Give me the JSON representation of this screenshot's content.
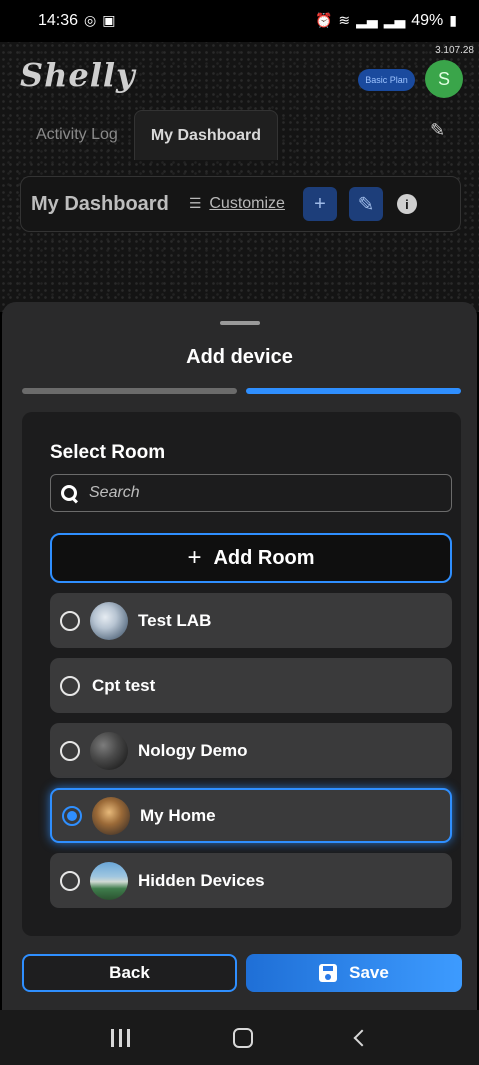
{
  "status_bar": {
    "time": "14:36",
    "battery": "49%",
    "left_icons": [
      "whatsapp-icon",
      "gallery-icon"
    ],
    "right_icons": [
      "alarm-icon",
      "wifi-icon",
      "signal-icon",
      "signal-icon",
      "battery-icon"
    ]
  },
  "background_app": {
    "version": "3.107.28",
    "logo": "Shelly",
    "plan_badge": "Basic Plan",
    "avatar_letter": "S",
    "tabs": [
      {
        "label": "Activity Log",
        "active": false
      },
      {
        "label": "My Dashboard",
        "active": true
      }
    ],
    "dashboard_title": "My Dashboard",
    "customize_label": "Customize"
  },
  "sheet": {
    "title": "Add device",
    "step": {
      "current": 2,
      "total": 2
    },
    "select_room_label": "Select Room",
    "search": {
      "placeholder": "Search",
      "value": ""
    },
    "add_room_label": "Add Room",
    "rooms": [
      {
        "label": "Test LAB",
        "selected": false,
        "has_image": true
      },
      {
        "label": "Cpt test",
        "selected": false,
        "has_image": false
      },
      {
        "label": "Nology Demo",
        "selected": false,
        "has_image": true
      },
      {
        "label": "My Home",
        "selected": true,
        "has_image": true
      },
      {
        "label": "Hidden Devices",
        "selected": false,
        "has_image": true
      }
    ],
    "back_label": "Back",
    "save_label": "Save"
  },
  "colors": {
    "accent": "#2f8fff",
    "sheet_bg": "#2a2a2b",
    "panel_bg": "#1c1c1d",
    "room_bg": "#3a3a3b"
  }
}
